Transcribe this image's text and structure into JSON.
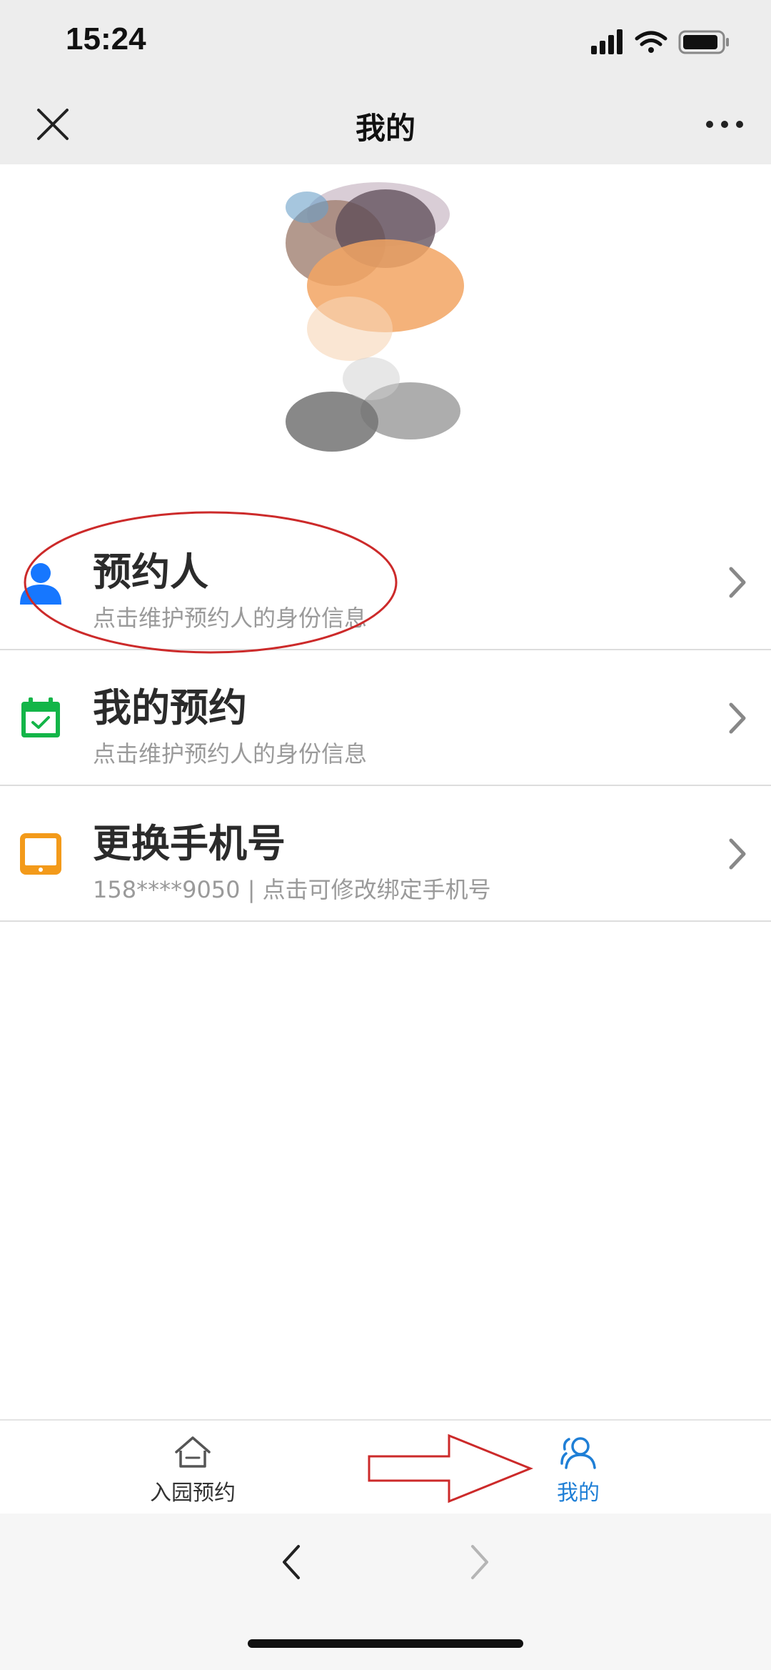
{
  "status_bar": {
    "time": "15:24"
  },
  "nav": {
    "title": "我的"
  },
  "menu": [
    {
      "title": "预约人",
      "subtitle": "点击维护预约人的身份信息",
      "icon": "person-icon",
      "color": "#1677ff"
    },
    {
      "title": "我的预约",
      "subtitle": "点击维护预约人的身份信息",
      "icon": "calendar-check-icon",
      "color": "#13b548"
    },
    {
      "title": "更换手机号",
      "subtitle": "158****9050 | 点击可修改绑定手机号",
      "icon": "phone-icon",
      "color": "#f39a1a"
    }
  ],
  "tabs": [
    {
      "label": "入园预约",
      "icon": "home-icon",
      "active": false
    },
    {
      "label": "我的",
      "icon": "users-icon",
      "active": true
    }
  ],
  "colors": {
    "accent": "#1f7fd6",
    "annotation": "#cc2a2a",
    "bar_bg": "#ededed"
  }
}
